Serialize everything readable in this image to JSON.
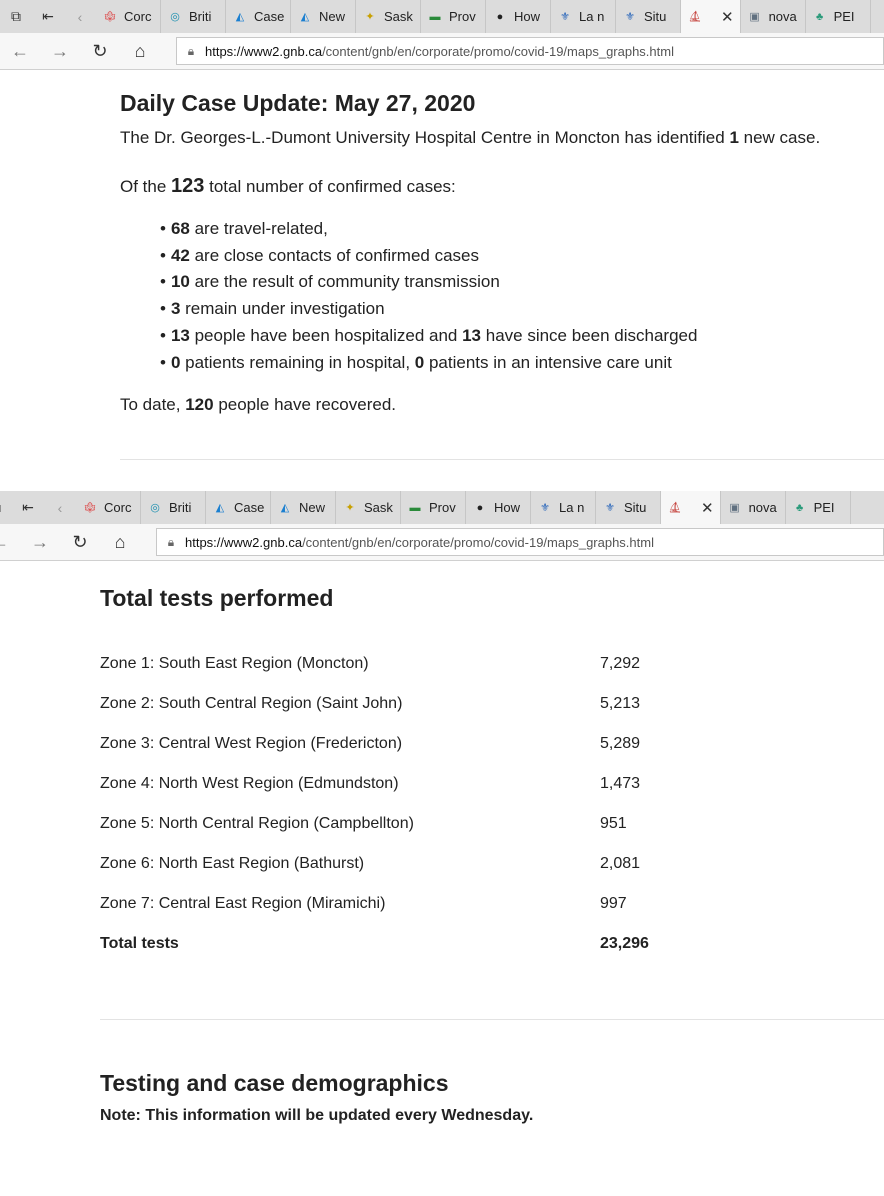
{
  "browser1": {
    "tabs": [
      {
        "label": "Corc",
        "icon": "maple-leaf-icon"
      },
      {
        "label": "Briti",
        "icon": "bc-icon"
      },
      {
        "label": "Case",
        "icon": "chart-icon"
      },
      {
        "label": "New",
        "icon": "chart-icon"
      },
      {
        "label": "Sask",
        "icon": "sask-icon"
      },
      {
        "label": "Prov",
        "icon": "green-flag-icon"
      },
      {
        "label": "How",
        "icon": "dark-circle-icon"
      },
      {
        "label": "La n",
        "icon": "quebec-icon"
      },
      {
        "label": "Situ",
        "icon": "quebec-icon"
      },
      {
        "label": "",
        "icon": "nb-icon",
        "active": true
      },
      {
        "label": "nova",
        "icon": "image-icon"
      },
      {
        "label": "PEI",
        "icon": "pei-icon"
      }
    ],
    "url_host": "https://www2.gnb.ca",
    "url_path": "/content/gnb/en/corporate/promo/covid-19/maps_graphs.html"
  },
  "browser2": {
    "tabs": [
      {
        "label": "Corc",
        "icon": "maple-leaf-icon"
      },
      {
        "label": "Briti",
        "icon": "bc-icon"
      },
      {
        "label": "Case",
        "icon": "chart-icon"
      },
      {
        "label": "New",
        "icon": "chart-icon"
      },
      {
        "label": "Sask",
        "icon": "sask-icon"
      },
      {
        "label": "Prov",
        "icon": "green-flag-icon"
      },
      {
        "label": "How",
        "icon": "dark-circle-icon"
      },
      {
        "label": "La n",
        "icon": "quebec-icon"
      },
      {
        "label": "Situ",
        "icon": "quebec-icon"
      },
      {
        "label": "",
        "icon": "nb-icon",
        "active": true
      },
      {
        "label": "nova",
        "icon": "image-icon"
      },
      {
        "label": "PEI",
        "icon": "pei-icon"
      }
    ],
    "url_host": "https://www2.gnb.ca",
    "url_path": "/content/gnb/en/corporate/promo/covid-19/maps_graphs.html"
  },
  "update": {
    "title": "Daily Case Update: May 27, 2020",
    "p1_a": "The Dr. Georges-L.-Dumont University Hospital Centre in Moncton has identified ",
    "p1_num": "1",
    "p1_b": " new case.",
    "p2_a": "Of the ",
    "p2_num": "123",
    "p2_b": " total number of confirmed cases:",
    "bullets": [
      {
        "n1": "68",
        "t1": " are travel-related,",
        "n2": "",
        "t2": ""
      },
      {
        "n1": "42",
        "t1": " are close contacts of confirmed cases",
        "n2": "",
        "t2": ""
      },
      {
        "n1": "10",
        "t1": " are the result of community transmission",
        "n2": "",
        "t2": ""
      },
      {
        "n1": "3",
        "t1": " remain under investigation",
        "n2": "",
        "t2": ""
      },
      {
        "n1": "13",
        "t1": " people have been hospitalized and ",
        "n2": "13",
        "t2": " have since been discharged"
      },
      {
        "n1": "0",
        "t1": " patients remaining in hospital, ",
        "n2": "0",
        "t2": " patients in an intensive care unit"
      }
    ],
    "p3_a": "To date, ",
    "p3_num": "120",
    "p3_b": " people have recovered."
  },
  "tests": {
    "title": "Total tests performed",
    "rows": [
      {
        "zone": "Zone 1: South East Region (Moncton)",
        "value": "7,292"
      },
      {
        "zone": "Zone 2: South Central Region (Saint John)",
        "value": "5,213"
      },
      {
        "zone": "Zone 3: Central West Region (Fredericton)",
        "value": "5,289"
      },
      {
        "zone": "Zone 4: North West Region (Edmundston)",
        "value": "1,473"
      },
      {
        "zone": "Zone 5: North Central Region (Campbellton)",
        "value": "951"
      },
      {
        "zone": "Zone 6: North East Region (Bathurst)",
        "value": "2,081"
      },
      {
        "zone": "Zone 7: Central East Region (Miramichi)",
        "value": "997"
      }
    ],
    "total_label": "Total tests",
    "total_value": "23,296"
  },
  "demographics": {
    "title": "Testing and case demographics",
    "note": "Note: This information will be updated every Wednesday."
  }
}
